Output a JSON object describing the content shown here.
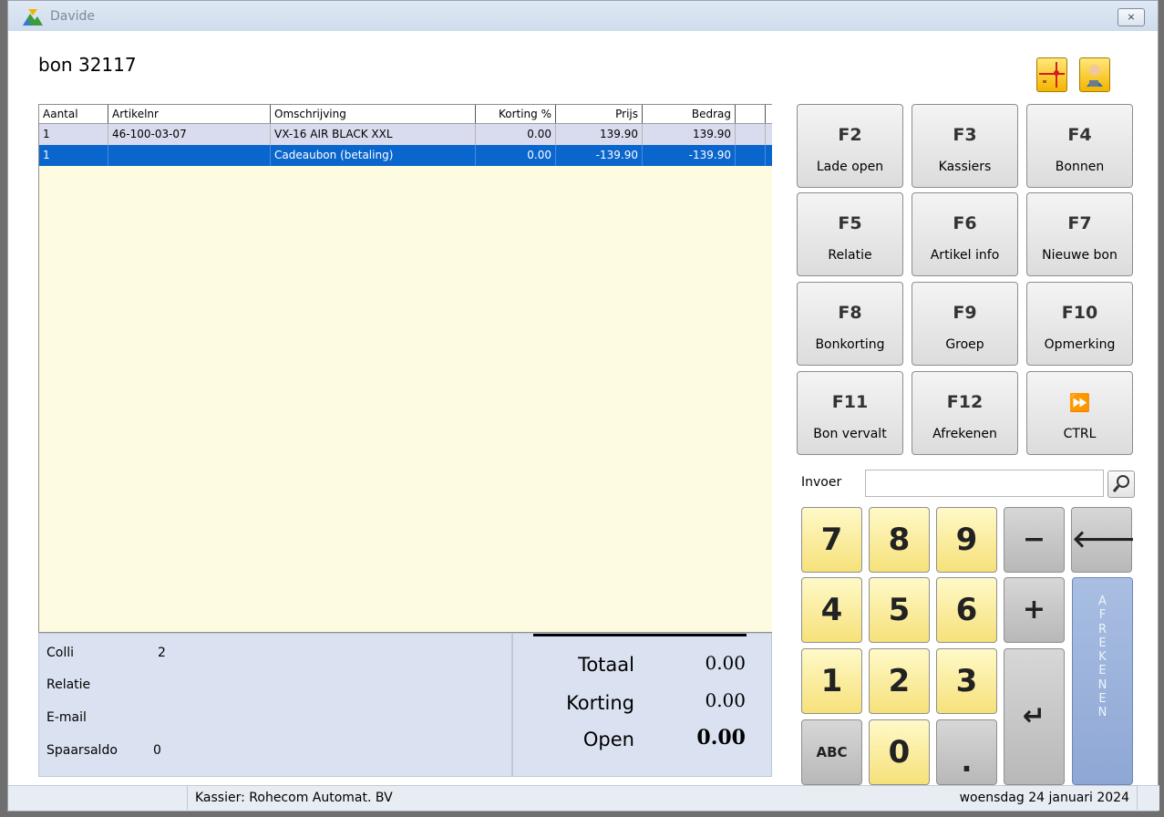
{
  "window": {
    "title": "Davide",
    "close": "⨯"
  },
  "bon": {
    "title": "bon 32117"
  },
  "grid": {
    "headers": [
      "Aantal",
      "Artikelnr",
      "Omschrijving",
      "Korting %",
      "Prijs",
      "Bedrag"
    ],
    "rows": [
      [
        "1",
        "46-100-03-07",
        "VX-16 AIR BLACK XXL",
        "0.00",
        "139.90",
        "139.90"
      ],
      [
        "1",
        "",
        "Cadeaubon (betaling)",
        "0.00",
        "-139.90",
        "-139.90"
      ]
    ],
    "selected_row": 1
  },
  "info": {
    "colli_label": "Colli",
    "colli_value": "2",
    "relatie_label": "Relatie",
    "email_label": "E-mail",
    "spaarsaldo_label": "Spaarsaldo",
    "spaarsaldo_value": "0"
  },
  "totals": {
    "totaal_label": "Totaal",
    "totaal_value": "0.00",
    "korting_label": "Korting",
    "korting_value": "0.00",
    "open_label": "Open",
    "open_value": "0.00"
  },
  "fkeys": [
    {
      "key": "F2",
      "label": "Lade open"
    },
    {
      "key": "F3",
      "label": "Kassiers"
    },
    {
      "key": "F4",
      "label": "Bonnen"
    },
    {
      "key": "F5",
      "label": "Relatie"
    },
    {
      "key": "F6",
      "label": "Artikel info"
    },
    {
      "key": "F7",
      "label": "Nieuwe bon"
    },
    {
      "key": "F8",
      "label": "Bonkorting"
    },
    {
      "key": "F9",
      "label": "Groep"
    },
    {
      "key": "F10",
      "label": "Opmerking"
    },
    {
      "key": "F11",
      "label": "Bon vervalt"
    },
    {
      "key": "F12",
      "label": "Afrekenen"
    },
    {
      "key": "⏩",
      "label": "CTRL"
    }
  ],
  "invoer": {
    "label": "Invoer",
    "value": "",
    "placeholder": ""
  },
  "keypad": {
    "k7": "7",
    "k8": "8",
    "k9": "9",
    "minus": "−",
    "backspace": "🡐",
    "k4": "4",
    "k5": "5",
    "k6": "6",
    "plus": "+",
    "k1": "1",
    "k2": "2",
    "k3": "3",
    "enter": "↵",
    "abc": "ABC",
    "k0": "0",
    "dot": ".",
    "afrekenen": "AFREKENEN"
  },
  "status": {
    "kassier": "Kassier: Rohecom Automat. BV",
    "date": "woensdag 24 januari 2024"
  },
  "colors": {
    "selection": "#0a66cc",
    "grid_bg": "#fefce0",
    "panel_bg": "#dae2f1",
    "key_yellow": "#f6e17a",
    "afrek_blue": "#8ea7d4"
  }
}
